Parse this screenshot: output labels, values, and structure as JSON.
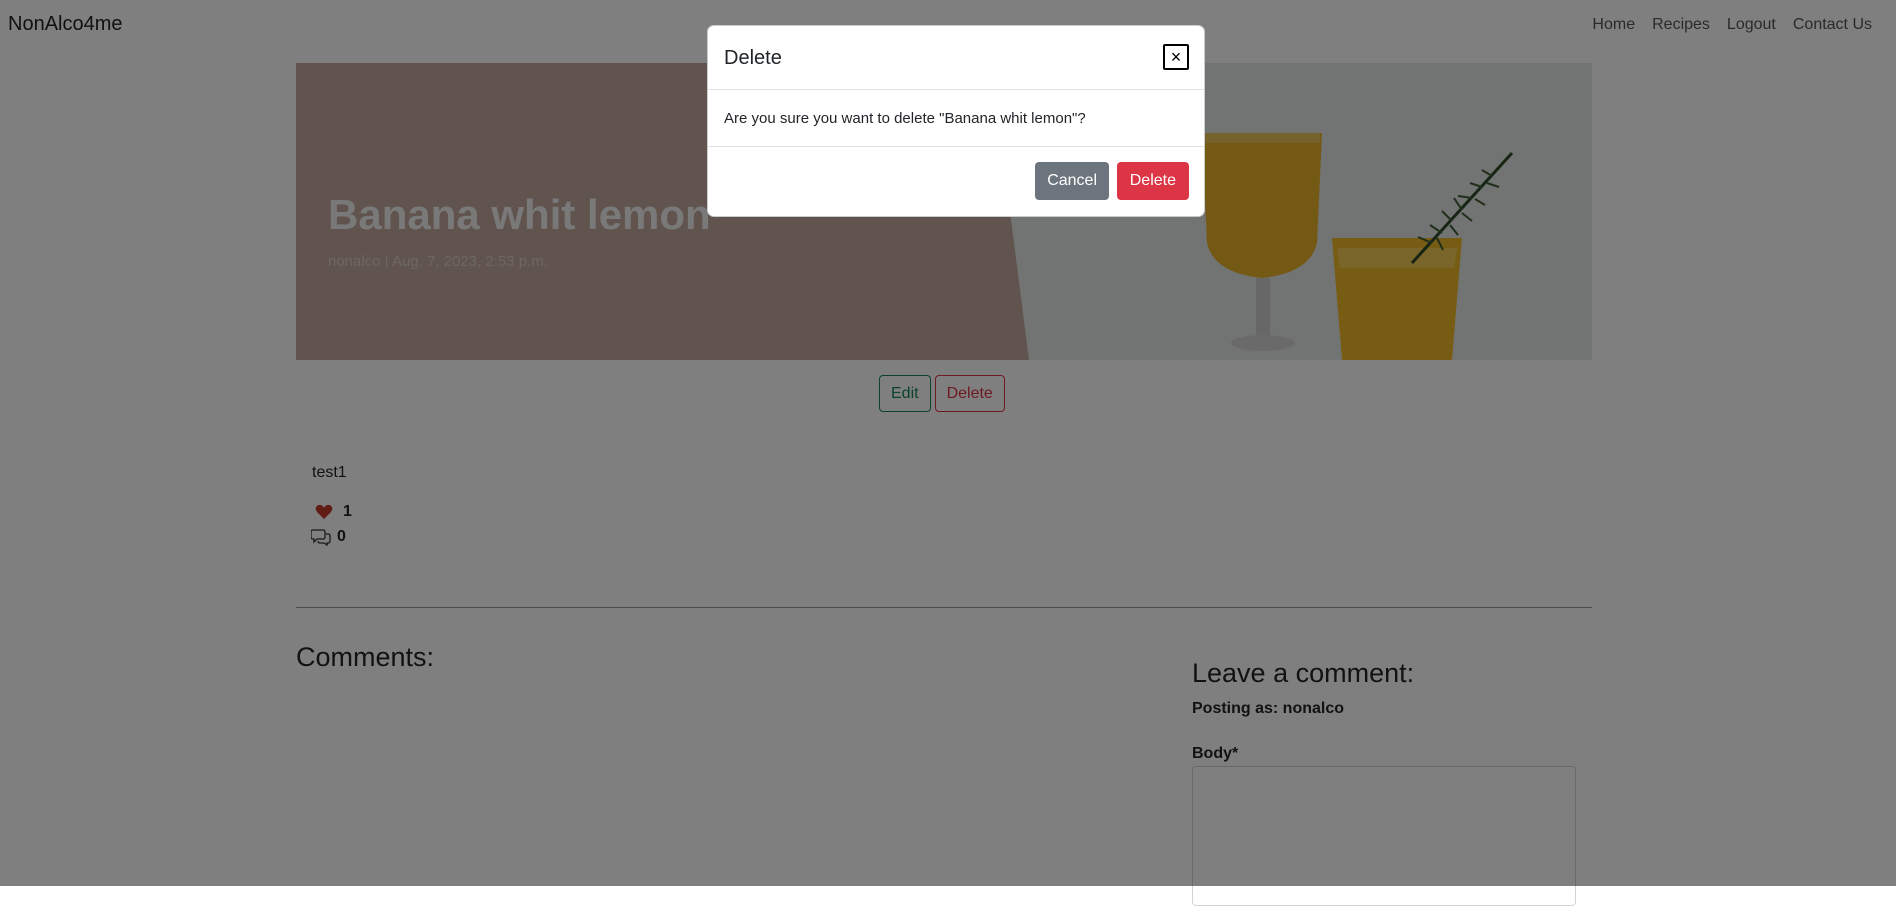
{
  "navbar": {
    "brand": "NonAlco4me",
    "links": [
      "Home",
      "Recipes",
      "Logout",
      "Contact Us"
    ]
  },
  "post": {
    "title": "Banana whit lemon",
    "meta": "nonalco | Aug. 7, 2023, 2:53 p.m.",
    "edit_label": "Edit",
    "delete_label": "Delete",
    "content": "test1",
    "likes": "1",
    "comment_count": "0",
    "like_icon": "heart-icon",
    "comment_icon": "chat-icon"
  },
  "comments": {
    "heading": "Comments:"
  },
  "comment_form": {
    "heading": "Leave a comment:",
    "posting_as": "Posting as: nonalco",
    "body_label": "Body*",
    "body_value": ""
  },
  "modal": {
    "title": "Delete",
    "close_glyph": "×",
    "message": "Are you sure you want to delete \"Banana whit lemon\"?",
    "cancel_label": "Cancel",
    "confirm_label": "Delete"
  },
  "colors": {
    "danger": "#dc3545",
    "success": "#198754",
    "secondary": "#6c757d",
    "heart": "#c0392b"
  }
}
